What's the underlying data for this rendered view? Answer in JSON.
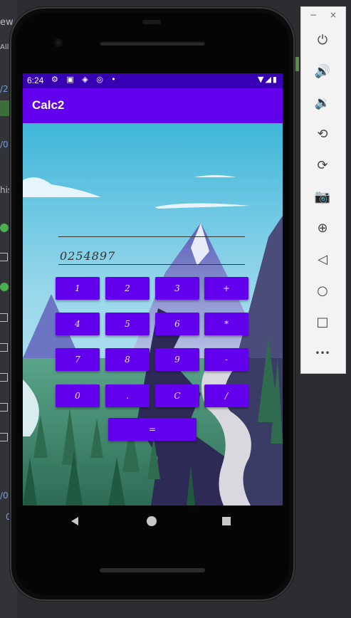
{
  "app": {
    "title": "Calc2"
  },
  "status_bar": {
    "time": "6:24",
    "icons": "⚙ ▣ ◈ ◎ •",
    "right_icons": "▼◢▮"
  },
  "display": {
    "value": "0254897"
  },
  "keypad": {
    "rows": [
      [
        "1",
        "2",
        "3",
        "+"
      ],
      [
        "4",
        "5",
        "6",
        "*"
      ],
      [
        "7",
        "8",
        "9",
        "-"
      ],
      [
        "0",
        ".",
        "C",
        "/"
      ]
    ],
    "equals": "="
  },
  "ide_fragments": [
    "ew",
    "All",
    "/2",
    "/0",
    "his",
    "/0",
    "0"
  ],
  "emulator": {
    "window_controls": [
      "−",
      "×"
    ],
    "buttons": [
      {
        "name": "power-icon",
        "glyph": "⏻"
      },
      {
        "name": "volume-up-icon",
        "glyph": "🔊"
      },
      {
        "name": "volume-down-icon",
        "glyph": "🔉"
      },
      {
        "name": "rotate-left-icon",
        "glyph": "⟲"
      },
      {
        "name": "rotate-right-icon",
        "glyph": "⟳"
      },
      {
        "name": "camera-icon",
        "glyph": "📷"
      },
      {
        "name": "zoom-icon",
        "glyph": "⊕"
      },
      {
        "name": "back-icon",
        "glyph": "◁"
      },
      {
        "name": "home-icon",
        "glyph": "○"
      },
      {
        "name": "overview-icon",
        "glyph": "□"
      },
      {
        "name": "more-icon",
        "glyph": "•••"
      }
    ]
  },
  "colors": {
    "app_bar": "#6200ee",
    "status_bar": "#3700b3",
    "button": "#6200ee"
  }
}
